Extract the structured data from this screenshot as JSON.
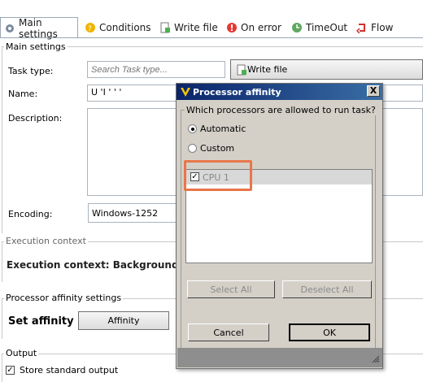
{
  "tabs": [
    {
      "label": "Main settings",
      "icon": "gear-icon"
    },
    {
      "label": "Conditions",
      "icon": "conditions-icon"
    },
    {
      "label": "Write file",
      "icon": "write-file-icon"
    },
    {
      "label": "On error",
      "icon": "error-icon"
    },
    {
      "label": "TimeOut",
      "icon": "timeout-icon"
    },
    {
      "label": "Flow",
      "icon": "flow-icon"
    }
  ],
  "main_settings": {
    "group_title": "Main settings",
    "task_type_label": "Task type:",
    "task_type_placeholder": "Search Task type...",
    "task_type_button": "Write file",
    "name_label": "Name:",
    "name_value": "U             'I ' ' '",
    "description_label": "Description:",
    "encoding_label": "Encoding:",
    "encoding_value": "Windows-1252"
  },
  "execution_context": {
    "group_title": "Execution context",
    "text": "Execution context: Background"
  },
  "processor_affinity_settings": {
    "group_title": "Processor affinity settings",
    "set_affinity_label": "Set affinity",
    "affinity_button": "Affinity"
  },
  "output": {
    "group_title": "Output",
    "store_standard_output": "Store standard output",
    "store_checked": true
  },
  "dialog": {
    "title": "Processor affinity",
    "close": "X",
    "question": "Which processors are allowed to run task?",
    "options": [
      "Automatic",
      "Custom"
    ],
    "selected_option": "Automatic",
    "cpu_items": [
      {
        "label": "CPU 1",
        "checked": true
      }
    ],
    "select_all": "Select All",
    "deselect_all": "Deselect All",
    "cancel": "Cancel",
    "ok": "OK"
  },
  "colors": {
    "title_bar": "#0a246a",
    "dialog_bg": "#d4d0c8",
    "highlight": "#e8764a"
  }
}
